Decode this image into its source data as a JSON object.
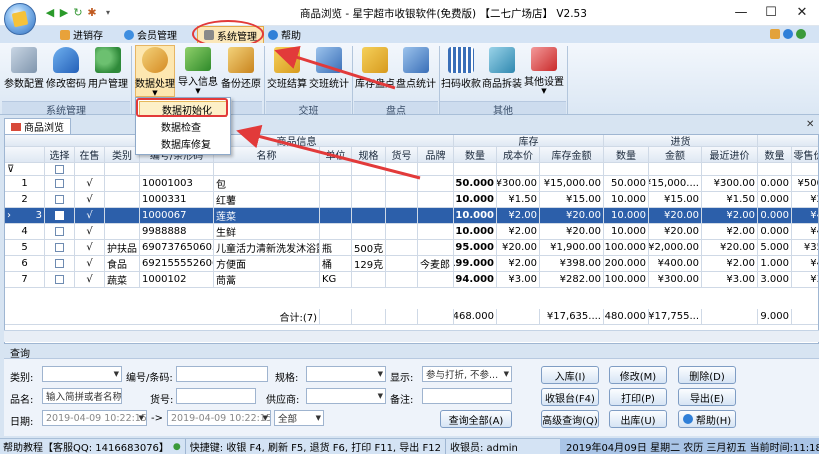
{
  "window": {
    "title": "商品浏览 - 星宇超市收银软件(免费版) 【二七广场店】 V2.53",
    "controls": {
      "minimize": "—",
      "maximize": "☐",
      "close": "✕"
    }
  },
  "menubar": {
    "items": [
      {
        "label": "进销存",
        "color": "#e8a23a"
      },
      {
        "label": "会员管理",
        "color": "#3e8ee0"
      },
      {
        "label": "系统管理",
        "color": "#8a8a8a"
      },
      {
        "label": "帮助",
        "color": "#2f7fd8"
      }
    ]
  },
  "ribbon": {
    "groups": [
      {
        "label": "系统管理",
        "buttons": [
          "参数配置",
          "修改密码",
          "用户管理"
        ]
      },
      {
        "label": "",
        "buttons": [
          "数据处理",
          "导入信息",
          "备份还原"
        ]
      },
      {
        "label": "交班",
        "buttons": [
          "交班结算",
          "交班统计"
        ]
      },
      {
        "label": "盘点",
        "buttons": [
          "库存盘点",
          "盘点统计"
        ]
      },
      {
        "label": "其他",
        "buttons": [
          "扫码收款",
          "商品拆装",
          "其他设置"
        ]
      }
    ]
  },
  "dropdown": {
    "items": [
      "数据初始化",
      "数据检查",
      "数据库修复"
    ]
  },
  "doc_tab": {
    "label": "商品浏览"
  },
  "grid": {
    "group_headers": [
      "商品信息",
      "库存",
      "进货"
    ],
    "columns": [
      "选择",
      "在售",
      "类别",
      "编号/条形码",
      "名称",
      "单位",
      "规格",
      "货号",
      "品牌",
      "数量",
      "成本价",
      "库存金额",
      "数量",
      "金额",
      "最近进价",
      "数量",
      "零售价"
    ],
    "rows": [
      {
        "no": "1",
        "check": "√",
        "cat": "",
        "code": "10001003",
        "name": "包",
        "unit": "",
        "spec": "",
        "art": "",
        "brand": "",
        "qty": "50.000",
        "cost": "¥300.00",
        "amt": "¥15,000.00",
        "pqty": "50.000",
        "pamt": "¥15,000....",
        "last": "¥300.00",
        "sqty": "0.000",
        "price": "¥500"
      },
      {
        "no": "2",
        "check": "√",
        "cat": "",
        "code": "1000331",
        "name": "红薯",
        "unit": "",
        "spec": "",
        "art": "",
        "brand": "",
        "qty": "10.000",
        "cost": "¥1.50",
        "amt": "¥15.00",
        "pqty": "10.000",
        "pamt": "¥15.00",
        "last": "¥1.50",
        "sqty": "0.000",
        "price": "¥2"
      },
      {
        "no": "3",
        "check": "√",
        "cat": "",
        "code": "1000067",
        "name": "莲菜",
        "unit": "",
        "spec": "",
        "art": "",
        "brand": "",
        "qty": "10.000",
        "cost": "¥2.00",
        "amt": "¥20.00",
        "pqty": "10.000",
        "pamt": "¥20.00",
        "last": "¥2.00",
        "sqty": "0.000",
        "price": "¥4"
      },
      {
        "no": "4",
        "check": "√",
        "cat": "",
        "code": "9988888",
        "name": "生鲜",
        "unit": "",
        "spec": "",
        "art": "",
        "brand": "",
        "qty": "10.000",
        "cost": "¥2.00",
        "amt": "¥20.00",
        "pqty": "10.000",
        "pamt": "¥20.00",
        "last": "¥2.00",
        "sqty": "0.000",
        "price": "¥4"
      },
      {
        "no": "5",
        "check": "√",
        "cat": "护扶品",
        "code": "6907376506058",
        "name": "儿童活力清新洗发沐浴露",
        "unit": "瓶",
        "spec": "500克",
        "art": "",
        "brand": "",
        "qty": "95.000",
        "cost": "¥20.00",
        "amt": "¥1,900.00",
        "pqty": "100.000",
        "pamt": "¥2,000.00",
        "last": "¥20.00",
        "sqty": "5.000",
        "price": "¥35"
      },
      {
        "no": "6",
        "check": "√",
        "cat": "食品",
        "code": "6921555526064",
        "name": "方便面",
        "unit": "桶",
        "spec": "129克",
        "art": "",
        "brand": "今麦郎",
        "qty": "199.000",
        "cost": "¥2.00",
        "amt": "¥398.00",
        "pqty": "200.000",
        "pamt": "¥400.00",
        "last": "¥2.00",
        "sqty": "1.000",
        "price": "¥4"
      },
      {
        "no": "7",
        "check": "√",
        "cat": "蔬菜",
        "code": "1000102",
        "name": "茼蒿",
        "unit": "KG",
        "spec": "",
        "art": "",
        "brand": "",
        "qty": "94.000",
        "cost": "¥3.00",
        "amt": "¥282.00",
        "pqty": "100.000",
        "pamt": "¥300.00",
        "last": "¥3.00",
        "sqty": "3.000",
        "price": "¥3"
      }
    ],
    "selected_row": 3,
    "footer": {
      "count": "合计:(7)",
      "qty": "468.000",
      "amt": "¥17,635....",
      "pqty": "480.000",
      "pamt": "¥17,755...",
      "sqty": "9.000"
    }
  },
  "query": {
    "title": "查询",
    "labels": {
      "category": "类别:",
      "code": "编号/条码:",
      "spec": "规格:",
      "display": "显示:",
      "name": "品名:",
      "art": "货号:",
      "supplier": "供应商:",
      "note": "备注:",
      "date": "日期:"
    },
    "name_value": "输入简拼或者名称",
    "display_value": "参与打折, 不参...",
    "date_from": "2019-04-09 10:22:15",
    "date_to": "2019-04-09 10:22:15",
    "date_range": "全部",
    "date_sep": "->",
    "buttons": [
      "入库(I)",
      "修改(M)",
      "删除(D)",
      "收银台(F4)",
      "打印(P)",
      "导出(E)",
      "查询全部(A)",
      "高级查询(Q)",
      "出库(U)",
      "帮助(H)"
    ]
  },
  "statusbar": {
    "help": "帮助教程【客服QQ: 1416683076】",
    "shortcuts": "快捷键: 收银 F4, 刷新 F5, 退货 F6, 打印 F11, 导出 F12",
    "cashier": "收银员: admin",
    "datetime": "2019年04月09日 星期二 农历 三月初五 当前时间:11:18:16"
  }
}
